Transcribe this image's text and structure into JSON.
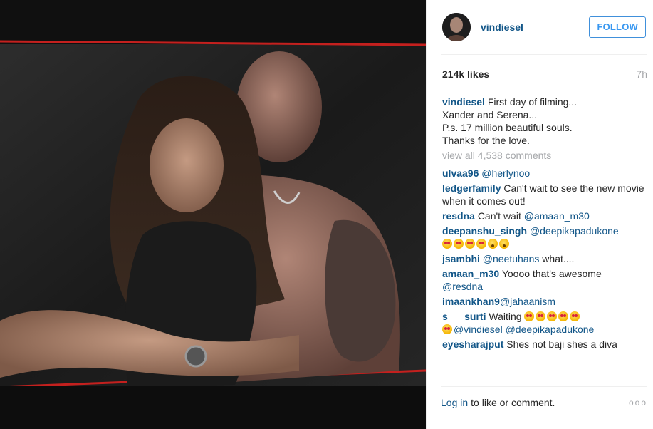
{
  "header": {
    "username": "vindiesel",
    "follow_label": "FOLLOW"
  },
  "stats": {
    "likes": "214k likes",
    "time": "7h"
  },
  "caption": {
    "username": "vindiesel",
    "lines": [
      "First day of filming...",
      "Xander and Serena...",
      "P.s. 17 million beautiful souls.",
      "Thanks for the love."
    ]
  },
  "view_all": "view all 4,538 comments",
  "comments": [
    {
      "user": "ulvaa96",
      "mention": "@herlynoo"
    },
    {
      "user": "ledgerfamily",
      "text": "Can't wait to see the new movie when it comes out!"
    },
    {
      "user": "resdna",
      "text": "Can't wait",
      "mention": "@amaan_m30"
    },
    {
      "user": "deepanshu_singh",
      "mention": "@deepikapadukone"
    },
    {
      "user": "jsambhi",
      "mention": "@neetuhans",
      "text": "what...."
    },
    {
      "user": "amaan_m30",
      "text": "Yoooo that's awesome",
      "mention": "@resdna"
    },
    {
      "user": "imaankhan9",
      "mention": "@jahaanism"
    },
    {
      "user": "s___surti",
      "text": "Waiting",
      "mention": "@vindiesel",
      "mention2": "@deepikapadukone"
    },
    {
      "user": "eyesharajput",
      "text": "Shes not baji shes a diva"
    }
  ],
  "footer": {
    "login": "Log in",
    "rest": "to like or comment.",
    "more": "ooo"
  },
  "icons": {
    "avatar": "profile-photo",
    "more": "ellipsis-icon"
  },
  "colors": {
    "link": "#125688",
    "follow": "#3897f0",
    "muted": "#a5a7aa"
  }
}
